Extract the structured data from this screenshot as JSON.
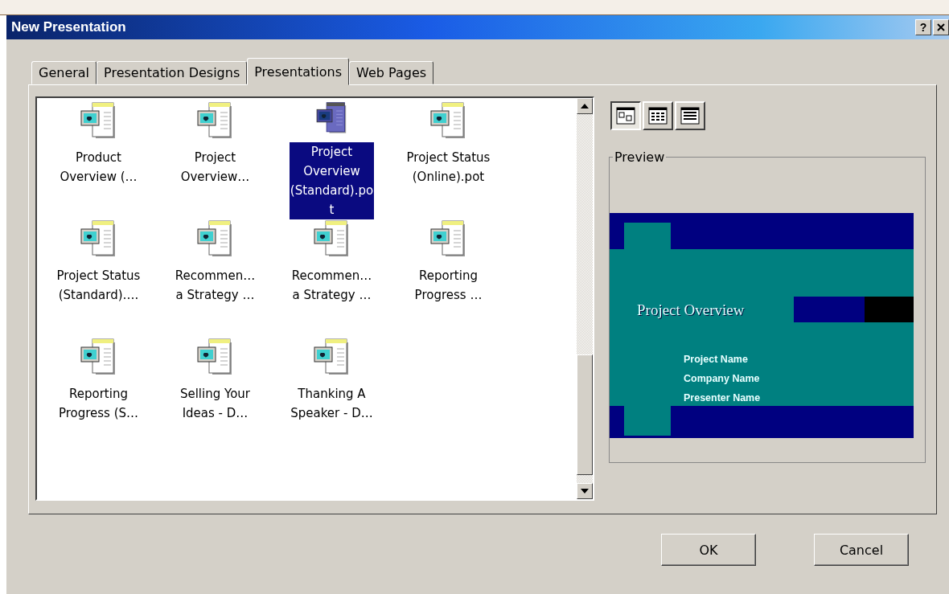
{
  "window": {
    "title": "New Presentation",
    "help": "?"
  },
  "tabs": [
    {
      "label": "General",
      "selected": false
    },
    {
      "label": "Presentation Designs",
      "selected": false
    },
    {
      "label": "Presentations",
      "selected": true
    },
    {
      "label": "Web Pages",
      "selected": false
    }
  ],
  "files": [
    {
      "label_lines": [
        "Product",
        "Overview (…"
      ],
      "selected": false
    },
    {
      "label_lines": [
        "Project",
        "Overview…"
      ],
      "selected": false
    },
    {
      "label_lines": [
        "Project",
        "Overview",
        "(Standard).po",
        "t"
      ],
      "selected": true
    },
    {
      "label_lines": [
        "Project Status",
        "(Online).pot"
      ],
      "selected": false
    },
    {
      "label_lines": [
        "Project Status",
        "(Standard)…."
      ],
      "selected": false
    },
    {
      "label_lines": [
        "Recommen…",
        "a Strategy …"
      ],
      "selected": false
    },
    {
      "label_lines": [
        "Recommen…",
        "a Strategy …"
      ],
      "selected": false
    },
    {
      "label_lines": [
        "Reporting",
        "Progress …"
      ],
      "selected": false
    },
    {
      "label_lines": [
        "Reporting",
        "Progress (S…"
      ],
      "selected": false
    },
    {
      "label_lines": [
        "Selling Your",
        "Ideas - D…"
      ],
      "selected": false
    },
    {
      "label_lines": [
        "Thanking A",
        "Speaker - D…"
      ],
      "selected": false
    }
  ],
  "view_buttons": [
    {
      "kind": "large-icons",
      "selected": true
    },
    {
      "kind": "list",
      "selected": false
    },
    {
      "kind": "details",
      "selected": false
    }
  ],
  "preview": {
    "label": "Preview",
    "slide": {
      "title": "Project Overview",
      "lines": [
        "Project Name",
        "Company Name",
        "Presenter Name"
      ]
    }
  },
  "buttons": [
    "OK",
    "Cancel"
  ]
}
